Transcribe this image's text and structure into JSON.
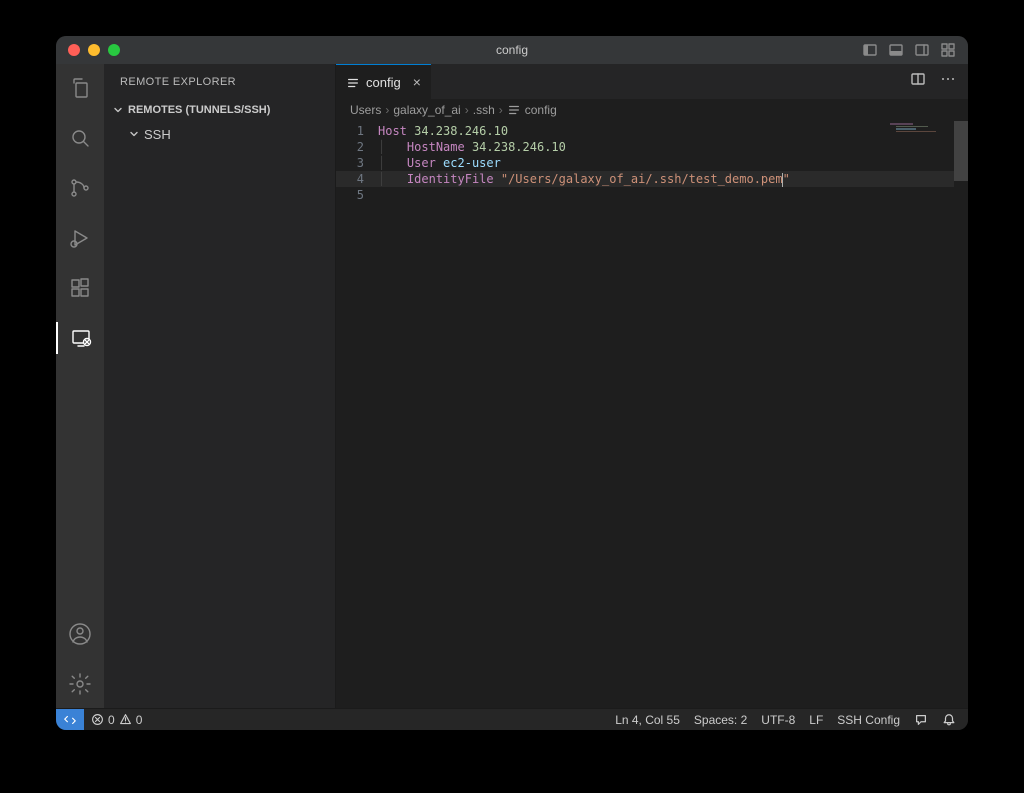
{
  "window": {
    "title": "config"
  },
  "sidebar": {
    "title": "REMOTE EXPLORER",
    "section_label": "REMOTES (TUNNELS/SSH)",
    "tree": [
      {
        "label": "SSH"
      }
    ]
  },
  "tabs": [
    {
      "label": "config",
      "icon": "list-icon"
    }
  ],
  "breadcrumbs": [
    {
      "label": "Users"
    },
    {
      "label": "galaxy_of_ai"
    },
    {
      "label": ".ssh"
    },
    {
      "label": "config",
      "icon": "list-icon"
    }
  ],
  "editor": {
    "lines": [
      {
        "n": "1",
        "segments": [
          {
            "t": "Host ",
            "c": "kw"
          },
          {
            "t": "34.238.246.10",
            "c": "num"
          }
        ]
      },
      {
        "n": "2",
        "segments": [
          {
            "t": "    ",
            "c": "indent"
          },
          {
            "t": "HostName ",
            "c": "kw"
          },
          {
            "t": "34.238.246.10",
            "c": "num"
          }
        ]
      },
      {
        "n": "3",
        "segments": [
          {
            "t": "    ",
            "c": "indent"
          },
          {
            "t": "User ",
            "c": "kw"
          },
          {
            "t": "ec2-user",
            "c": "id"
          }
        ]
      },
      {
        "n": "4",
        "hl": true,
        "cursor": true,
        "segments": [
          {
            "t": "    ",
            "c": "indent"
          },
          {
            "t": "IdentityFile ",
            "c": "kw"
          },
          {
            "t": "\"/Users/galaxy_of_ai/.ssh/test_demo.pem\"",
            "c": "str"
          }
        ]
      },
      {
        "n": "5",
        "segments": []
      }
    ]
  },
  "statusbar": {
    "errors": "0",
    "warnings": "0",
    "cursor": "Ln 4, Col 55",
    "spaces": "Spaces: 2",
    "encoding": "UTF-8",
    "eol": "LF",
    "language": "SSH Config"
  }
}
